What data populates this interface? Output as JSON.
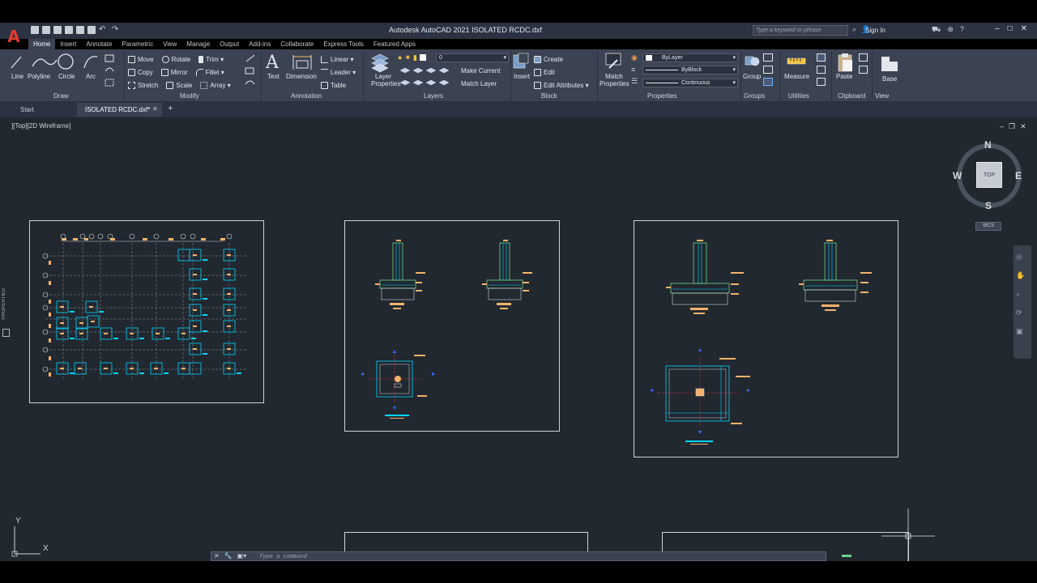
{
  "app": {
    "title": "Autodesk AutoCAD 2021   ISOLATED RCDC.dxf",
    "logo": "A",
    "search_placeholder": "Type a keyword or phrase",
    "sign_in": "Sign In"
  },
  "ribbon_tabs": [
    "Home",
    "Insert",
    "Annotate",
    "Parametric",
    "View",
    "Manage",
    "Output",
    "Add-ins",
    "Collaborate",
    "Express Tools",
    "Featured Apps"
  ],
  "active_tab": "Home",
  "ribbon": {
    "draw": {
      "title": "Draw",
      "tools": [
        "Line",
        "Polyline",
        "Circle",
        "Arc"
      ]
    },
    "modify": {
      "title": "Modify",
      "row1": [
        "Move",
        "Rotate",
        "Trim"
      ],
      "row2": [
        "Copy",
        "Mirror",
        "Fillet"
      ],
      "row3": [
        "Stretch",
        "Scale",
        "Array"
      ]
    },
    "annotation": {
      "title": "Annotation",
      "text": "Text",
      "dimension": "Dimension",
      "linear": "Linear",
      "leader": "Leader",
      "table": "Table"
    },
    "layers": {
      "title": "Layers",
      "layer_properties": "Layer Properties",
      "current_layer": "0",
      "make_current": "Make Current",
      "match_layer": "Match Layer"
    },
    "block": {
      "title": "Block",
      "insert": "Insert",
      "create": "Create",
      "edit": "Edit",
      "edit_attributes": "Edit Attributes"
    },
    "properties": {
      "title": "Properties",
      "match_properties": "Match Properties",
      "color": "ByLayer",
      "lineweight": "ByBlock",
      "linetype": "Continuous"
    },
    "groups": {
      "title": "Groups",
      "group": "Group"
    },
    "utilities": {
      "title": "Utilities",
      "measure": "Measure"
    },
    "clipboard": {
      "title": "Clipboard",
      "paste": "Paste"
    },
    "view": {
      "title": "View",
      "base": "Base"
    }
  },
  "file_tabs": [
    "Start",
    "ISOLATED RCDC.dxf*"
  ],
  "viewport_label": "][Top][2D Wireframe]",
  "side_panel_label": "PROPERTIES",
  "viewcube": {
    "n": "N",
    "s": "S",
    "e": "E",
    "w": "W",
    "top": "TOP",
    "wcs": "WCS"
  },
  "ucs": {
    "y": "Y",
    "x": "X"
  },
  "command_placeholder": "Type a command",
  "colors": {
    "canvas": "#212830",
    "ribbon": "#3b4353",
    "cyan": "#00d5ff",
    "blue": "#3a6cff",
    "orange": "#f5b26b",
    "green": "#6fd18a",
    "autocad_red": "#e03c31"
  }
}
